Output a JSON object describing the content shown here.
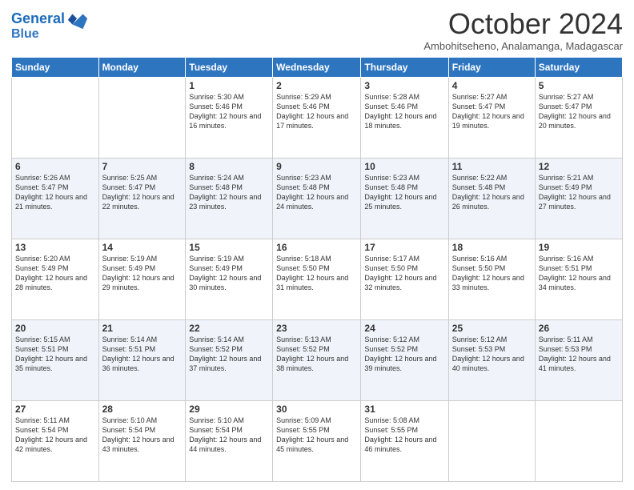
{
  "header": {
    "logo_line1": "General",
    "logo_line2": "Blue",
    "month_year": "October 2024",
    "location": "Ambohitseheno, Analamanga, Madagascar"
  },
  "weekdays": [
    "Sunday",
    "Monday",
    "Tuesday",
    "Wednesday",
    "Thursday",
    "Friday",
    "Saturday"
  ],
  "weeks": [
    [
      {
        "day": "",
        "info": ""
      },
      {
        "day": "",
        "info": ""
      },
      {
        "day": "1",
        "info": "Sunrise: 5:30 AM\nSunset: 5:46 PM\nDaylight: 12 hours and 16 minutes."
      },
      {
        "day": "2",
        "info": "Sunrise: 5:29 AM\nSunset: 5:46 PM\nDaylight: 12 hours and 17 minutes."
      },
      {
        "day": "3",
        "info": "Sunrise: 5:28 AM\nSunset: 5:46 PM\nDaylight: 12 hours and 18 minutes."
      },
      {
        "day": "4",
        "info": "Sunrise: 5:27 AM\nSunset: 5:47 PM\nDaylight: 12 hours and 19 minutes."
      },
      {
        "day": "5",
        "info": "Sunrise: 5:27 AM\nSunset: 5:47 PM\nDaylight: 12 hours and 20 minutes."
      }
    ],
    [
      {
        "day": "6",
        "info": "Sunrise: 5:26 AM\nSunset: 5:47 PM\nDaylight: 12 hours and 21 minutes."
      },
      {
        "day": "7",
        "info": "Sunrise: 5:25 AM\nSunset: 5:47 PM\nDaylight: 12 hours and 22 minutes."
      },
      {
        "day": "8",
        "info": "Sunrise: 5:24 AM\nSunset: 5:48 PM\nDaylight: 12 hours and 23 minutes."
      },
      {
        "day": "9",
        "info": "Sunrise: 5:23 AM\nSunset: 5:48 PM\nDaylight: 12 hours and 24 minutes."
      },
      {
        "day": "10",
        "info": "Sunrise: 5:23 AM\nSunset: 5:48 PM\nDaylight: 12 hours and 25 minutes."
      },
      {
        "day": "11",
        "info": "Sunrise: 5:22 AM\nSunset: 5:48 PM\nDaylight: 12 hours and 26 minutes."
      },
      {
        "day": "12",
        "info": "Sunrise: 5:21 AM\nSunset: 5:49 PM\nDaylight: 12 hours and 27 minutes."
      }
    ],
    [
      {
        "day": "13",
        "info": "Sunrise: 5:20 AM\nSunset: 5:49 PM\nDaylight: 12 hours and 28 minutes."
      },
      {
        "day": "14",
        "info": "Sunrise: 5:19 AM\nSunset: 5:49 PM\nDaylight: 12 hours and 29 minutes."
      },
      {
        "day": "15",
        "info": "Sunrise: 5:19 AM\nSunset: 5:49 PM\nDaylight: 12 hours and 30 minutes."
      },
      {
        "day": "16",
        "info": "Sunrise: 5:18 AM\nSunset: 5:50 PM\nDaylight: 12 hours and 31 minutes."
      },
      {
        "day": "17",
        "info": "Sunrise: 5:17 AM\nSunset: 5:50 PM\nDaylight: 12 hours and 32 minutes."
      },
      {
        "day": "18",
        "info": "Sunrise: 5:16 AM\nSunset: 5:50 PM\nDaylight: 12 hours and 33 minutes."
      },
      {
        "day": "19",
        "info": "Sunrise: 5:16 AM\nSunset: 5:51 PM\nDaylight: 12 hours and 34 minutes."
      }
    ],
    [
      {
        "day": "20",
        "info": "Sunrise: 5:15 AM\nSunset: 5:51 PM\nDaylight: 12 hours and 35 minutes."
      },
      {
        "day": "21",
        "info": "Sunrise: 5:14 AM\nSunset: 5:51 PM\nDaylight: 12 hours and 36 minutes."
      },
      {
        "day": "22",
        "info": "Sunrise: 5:14 AM\nSunset: 5:52 PM\nDaylight: 12 hours and 37 minutes."
      },
      {
        "day": "23",
        "info": "Sunrise: 5:13 AM\nSunset: 5:52 PM\nDaylight: 12 hours and 38 minutes."
      },
      {
        "day": "24",
        "info": "Sunrise: 5:12 AM\nSunset: 5:52 PM\nDaylight: 12 hours and 39 minutes."
      },
      {
        "day": "25",
        "info": "Sunrise: 5:12 AM\nSunset: 5:53 PM\nDaylight: 12 hours and 40 minutes."
      },
      {
        "day": "26",
        "info": "Sunrise: 5:11 AM\nSunset: 5:53 PM\nDaylight: 12 hours and 41 minutes."
      }
    ],
    [
      {
        "day": "27",
        "info": "Sunrise: 5:11 AM\nSunset: 5:54 PM\nDaylight: 12 hours and 42 minutes."
      },
      {
        "day": "28",
        "info": "Sunrise: 5:10 AM\nSunset: 5:54 PM\nDaylight: 12 hours and 43 minutes."
      },
      {
        "day": "29",
        "info": "Sunrise: 5:10 AM\nSunset: 5:54 PM\nDaylight: 12 hours and 44 minutes."
      },
      {
        "day": "30",
        "info": "Sunrise: 5:09 AM\nSunset: 5:55 PM\nDaylight: 12 hours and 45 minutes."
      },
      {
        "day": "31",
        "info": "Sunrise: 5:08 AM\nSunset: 5:55 PM\nDaylight: 12 hours and 46 minutes."
      },
      {
        "day": "",
        "info": ""
      },
      {
        "day": "",
        "info": ""
      }
    ]
  ]
}
